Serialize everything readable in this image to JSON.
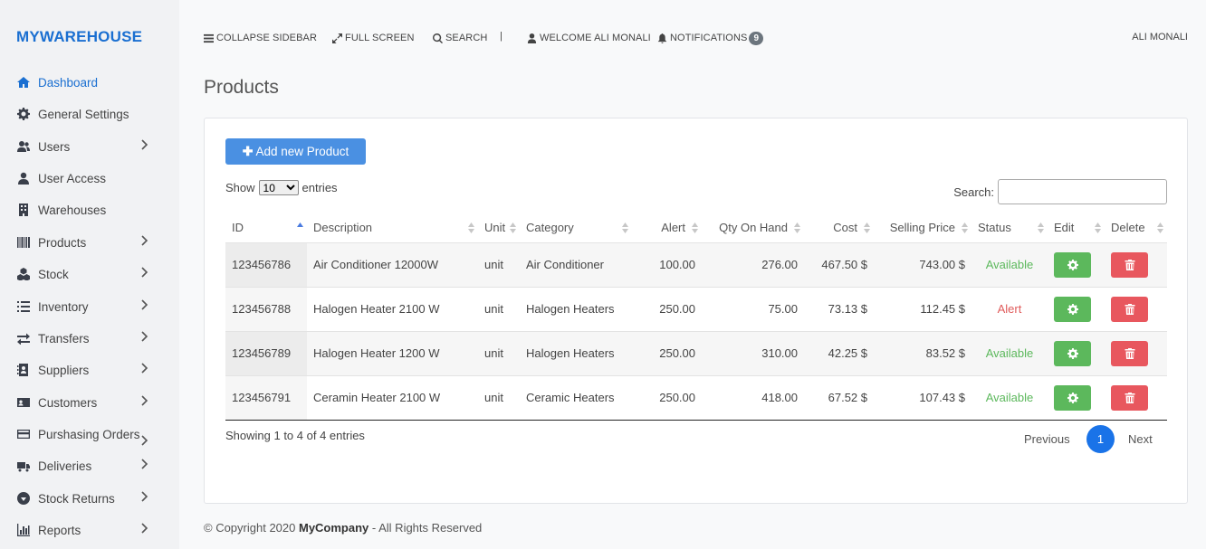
{
  "brand": "MYWAREHOUSE",
  "sidebar": {
    "items": [
      {
        "label": "Dashboard",
        "icon": "home-icon",
        "active": true,
        "chevron": false
      },
      {
        "label": "General Settings",
        "icon": "gear-icon",
        "chevron": false
      },
      {
        "label": "Users",
        "icon": "users-icon",
        "chevron": true
      },
      {
        "label": "User Access",
        "icon": "user-icon",
        "chevron": false
      },
      {
        "label": "Warehouses",
        "icon": "building-icon",
        "chevron": false
      },
      {
        "label": "Products",
        "icon": "barcode-icon",
        "chevron": true
      },
      {
        "label": "Stock",
        "icon": "cubes-icon",
        "chevron": true
      },
      {
        "label": "Inventory",
        "icon": "list-icon",
        "chevron": true
      },
      {
        "label": "Transfers",
        "icon": "exchange-icon",
        "chevron": true
      },
      {
        "label": "Suppliers",
        "icon": "address-book-icon",
        "chevron": true
      },
      {
        "label": "Customers",
        "icon": "id-card-icon",
        "chevron": true
      },
      {
        "label": "Purshasing Orders",
        "icon": "credit-card-icon",
        "chevron": true
      },
      {
        "label": "Deliveries",
        "icon": "truck-icon",
        "chevron": true
      },
      {
        "label": "Stock Returns",
        "icon": "arrow-circle-icon",
        "chevron": true
      },
      {
        "label": "Reports",
        "icon": "bar-chart-icon",
        "chevron": true
      }
    ]
  },
  "topbar": {
    "collapse": "COLLAPSE SIDEBAR",
    "fullscreen": "FULL SCREEN",
    "search": "SEARCH",
    "separator": "|",
    "welcome": "WELCOME ALI MONALI",
    "notifications": "NOTIFICATIONS",
    "notification_count": "9",
    "user": "ALI MONALI"
  },
  "page_title": "Products",
  "add_button": "Add new Product",
  "show": {
    "prefix": "Show",
    "value": "10",
    "suffix": "entries",
    "options": [
      "10"
    ]
  },
  "search_label": "Search:",
  "table": {
    "headers": [
      "ID",
      "Description",
      "Unit",
      "Category",
      "Alert",
      "Qty On Hand",
      "Cost",
      "Selling Price",
      "Status",
      "Edit",
      "Delete"
    ],
    "rows": [
      {
        "id": "123456786",
        "description": "Air Conditioner 12000W",
        "unit": "unit",
        "category": "Air Conditioner",
        "alert": "100.00",
        "qty": "276.00",
        "cost": "467.50 $",
        "price": "743.00 $",
        "status": "Available"
      },
      {
        "id": "123456788",
        "description": "Halogen Heater 2100 W",
        "unit": "unit",
        "category": "Halogen Heaters",
        "alert": "250.00",
        "qty": "75.00",
        "cost": "73.13 $",
        "price": "112.45 $",
        "status": "Alert"
      },
      {
        "id": "123456789",
        "description": "Halogen Heater 1200 W",
        "unit": "unit",
        "category": "Halogen Heaters",
        "alert": "250.00",
        "qty": "310.00",
        "cost": "42.25 $",
        "price": "83.52 $",
        "status": "Available"
      },
      {
        "id": "123456791",
        "description": "Ceramin Heater 2100 W",
        "unit": "unit",
        "category": "Ceramic Heaters",
        "alert": "250.00",
        "qty": "418.00",
        "cost": "67.52 $",
        "price": "107.43 $",
        "status": "Available"
      }
    ]
  },
  "info": "Showing 1 to 4 of 4 entries",
  "pagination": {
    "previous": "Previous",
    "current": "1",
    "next": "Next"
  },
  "footer": {
    "prefix": "© Copyright 2020 ",
    "company": "MyCompany",
    "suffix": " - All Rights Reserved"
  },
  "colors": {
    "accent": "#1a6fd1",
    "available": "#5cb85c",
    "alert": "#e05b5b",
    "edit": "#5cb85c",
    "delete": "#e8575e",
    "add": "#4a90e2"
  }
}
